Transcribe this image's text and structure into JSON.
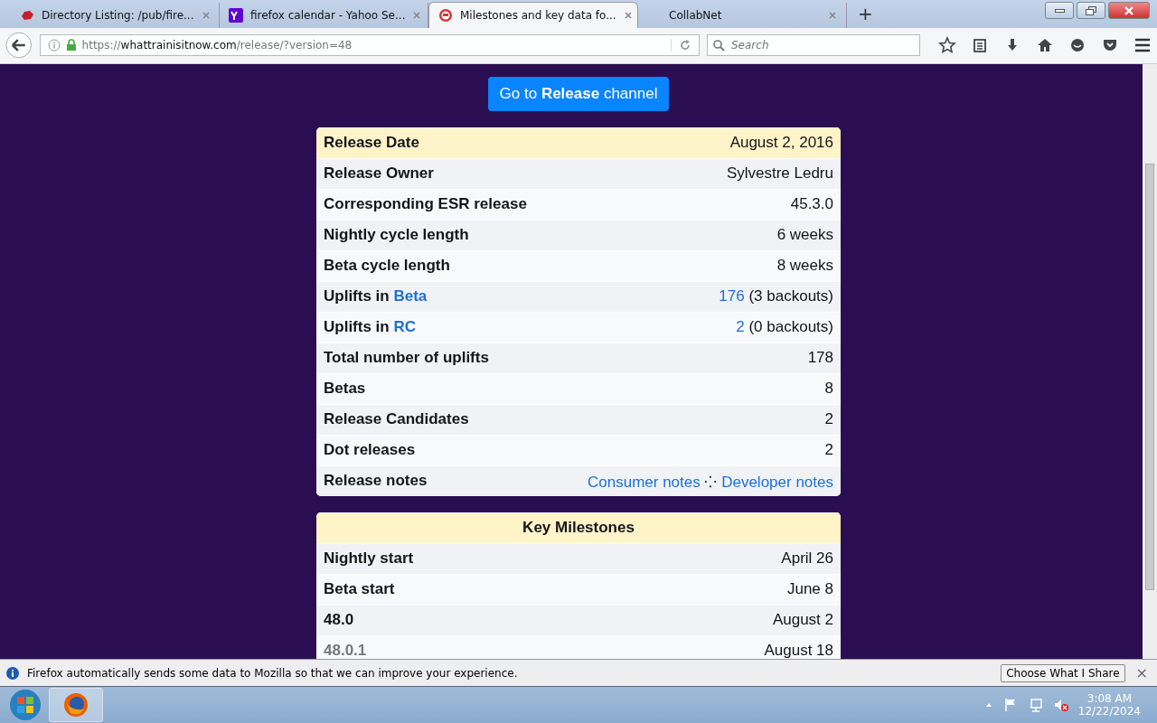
{
  "tabs": [
    {
      "title": "Directory Listing: /pub/fire...",
      "kind": "bug",
      "selected": false
    },
    {
      "title": "firefox calendar - Yahoo Se...",
      "kind": "yahoo",
      "selected": false
    },
    {
      "title": "Milestones and key data fo...",
      "kind": "milestone",
      "selected": true
    },
    {
      "title": "CollabNet",
      "kind": "plain",
      "selected": false
    }
  ],
  "new_tab": "+",
  "address": {
    "scheme": "https://",
    "host": "whattrainisitnow.com",
    "path": "/release/?version=48"
  },
  "search": {
    "placeholder": "Search"
  },
  "channel_button": {
    "before": "Go to ",
    "bold": "Release",
    "after": " channel"
  },
  "release_card": {
    "rows": [
      {
        "label": "Release Date",
        "value": "August 2, 2016",
        "header": true
      },
      {
        "label": "Release Owner",
        "value": "Sylvestre Ledru",
        "header": false
      },
      {
        "label": "Corresponding ESR release",
        "value": "45.3.0",
        "header": false
      },
      {
        "label": "Nightly cycle length",
        "value": "6 weeks",
        "header": false
      },
      {
        "label": "Beta cycle length",
        "value": "8 weeks",
        "header": false
      },
      {
        "label": "Uplifts in",
        "label_link": "Beta",
        "value_link": "176",
        "value": "(3 backouts)",
        "header": false
      },
      {
        "label": "Uplifts in",
        "label_link": "RC",
        "value_link": "2",
        "value": "(0 backouts)",
        "header": false
      },
      {
        "label": "Total number of uplifts",
        "value": "178",
        "header": false
      },
      {
        "label": "Betas",
        "value": "8",
        "header": false
      },
      {
        "label": "Release Candidates",
        "value": "2",
        "header": false
      },
      {
        "label": "Dot releases",
        "value": "2",
        "header": false
      },
      {
        "label": "Release notes",
        "links": [
          "Consumer notes",
          "Developer notes"
        ],
        "separator": "⁘",
        "header": false
      }
    ]
  },
  "milestones": {
    "title": "Key Milestones",
    "rows": [
      {
        "label": "Nightly start",
        "value": "April 26",
        "muted": false
      },
      {
        "label": "Beta start",
        "value": "June 8",
        "muted": false
      },
      {
        "label": "48.0",
        "value": "August 2",
        "muted": false
      },
      {
        "label": "48.0.1",
        "value": "August 18",
        "muted": true
      }
    ]
  },
  "notification": {
    "message": "Firefox automatically sends some data to Mozilla so that we can improve your experience.",
    "button": "Choose What I Share",
    "close": "×"
  },
  "clock": {
    "time": "3:08 AM",
    "date": "12/22/2024"
  }
}
